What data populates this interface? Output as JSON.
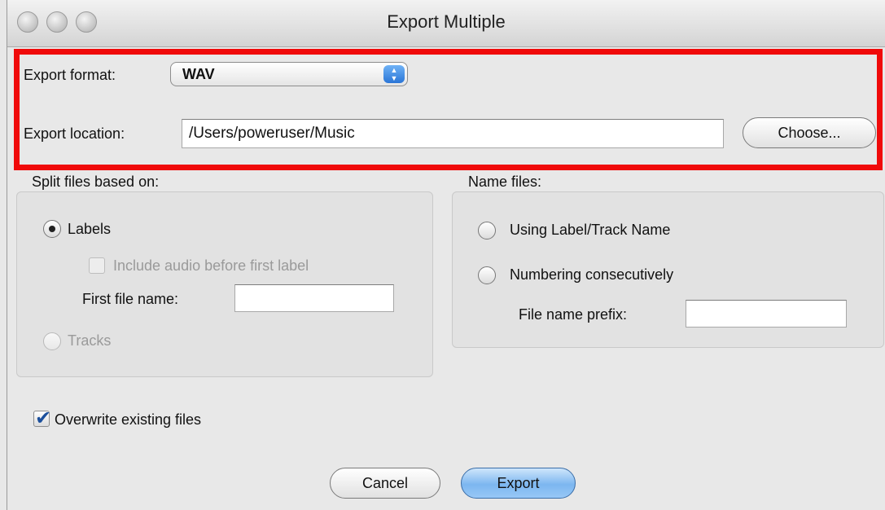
{
  "window": {
    "title": "Export Multiple"
  },
  "export": {
    "format_label": "Export format:",
    "format_value": "WAV",
    "location_label": "Export location:",
    "location_value": "/Users/poweruser/Music",
    "choose_label": "Choose..."
  },
  "split": {
    "heading": "Split files based on:",
    "labels_option": "Labels",
    "labels_selected": true,
    "include_audio_label": "Include audio before first label",
    "include_audio_checked": false,
    "first_file_name_label": "First file name:",
    "first_file_name_value": "",
    "tracks_option": "Tracks",
    "tracks_selected": false
  },
  "name": {
    "heading": "Name files:",
    "using_label_option": "Using Label/Track Name",
    "numbering_option": "Numbering consecutively",
    "prefix_label": "File name prefix:",
    "prefix_value": ""
  },
  "overwrite": {
    "label": "Overwrite existing files",
    "checked": true
  },
  "footer": {
    "cancel_label": "Cancel",
    "export_label": "Export"
  },
  "colors": {
    "highlight": "#f00a0a",
    "accent": "#2a75d6"
  }
}
